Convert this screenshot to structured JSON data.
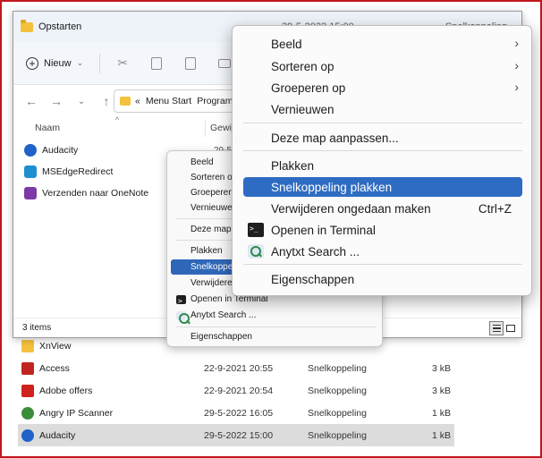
{
  "window": {
    "title": "Opstarten",
    "title_date_fragment": "29-5-2022 15:00",
    "title_type_fragment": "Snelkoppeling"
  },
  "toolbar": {
    "new_label": "Nieuw"
  },
  "address": {
    "crumbs": [
      "«",
      "Menu Start",
      "Program"
    ]
  },
  "columns": {
    "name": "Naam",
    "date": "Gewij"
  },
  "files": [
    {
      "name": "Audacity",
      "date": "29-5",
      "color": "#1f62c8"
    },
    {
      "name": "MSEdgeRedirect",
      "date": "",
      "color": "#1f8fd0"
    },
    {
      "name": "Verzenden naar OneNote",
      "date": "",
      "color": "#7b3aa6"
    }
  ],
  "status": {
    "count": "3 items"
  },
  "small_menu": {
    "items": [
      {
        "label": "Beeld"
      },
      {
        "label": "Sorteren op"
      },
      {
        "label": "Groeperen op"
      },
      {
        "label": "Vernieuwen"
      },
      {
        "label": "Deze map aanpassen..."
      },
      {
        "label": "Plakken"
      },
      {
        "label": "Snelkoppeling plakken"
      },
      {
        "label": "Verwijderen ongedaan maken"
      },
      {
        "label": "Openen in Terminal"
      },
      {
        "label": "Anytxt Search ..."
      },
      {
        "label": "Eigenschappen"
      }
    ]
  },
  "context_menu": {
    "items": [
      {
        "label": "Beeld",
        "submenu": true
      },
      {
        "label": "Sorteren op",
        "submenu": true
      },
      {
        "label": "Groeperen op",
        "submenu": true
      },
      {
        "label": "Vernieuwen"
      },
      {
        "label": "Deze map aanpassen..."
      },
      {
        "label": "Plakken"
      },
      {
        "label": "Snelkoppeling plakken",
        "highlighted": true
      },
      {
        "label": "Verwijderen ongedaan maken",
        "shortcut": "Ctrl+Z"
      },
      {
        "label": "Openen in Terminal",
        "icon": "terminal-icon"
      },
      {
        "label": "Anytxt Search ...",
        "icon": "search-icon"
      },
      {
        "label": "Eigenschappen"
      }
    ],
    "submenu_glyph": "›"
  },
  "background_list": [
    {
      "name": "XnView",
      "date": "",
      "type": "",
      "size": "",
      "color": "#f3c13b"
    },
    {
      "name": "Access",
      "date": "22-9-2021 20:55",
      "type": "Snelkoppeling",
      "size": "3 kB",
      "color": "#c0261f"
    },
    {
      "name": "Adobe offers",
      "date": "22-9-2021 20:54",
      "type": "Snelkoppeling",
      "size": "3 kB",
      "color": "#d0221c"
    },
    {
      "name": "Angry IP Scanner",
      "date": "29-5-2022 16:05",
      "type": "Snelkoppeling",
      "size": "1 kB",
      "color": "#3a8d3a"
    },
    {
      "name": "Audacity",
      "date": "29-5-2022 15:00",
      "type": "Snelkoppeling",
      "size": "1 kB",
      "color": "#1f62c8",
      "selected": true
    }
  ],
  "colors": {
    "accent": "#2e6cc3",
    "frame": "#c0171d"
  }
}
